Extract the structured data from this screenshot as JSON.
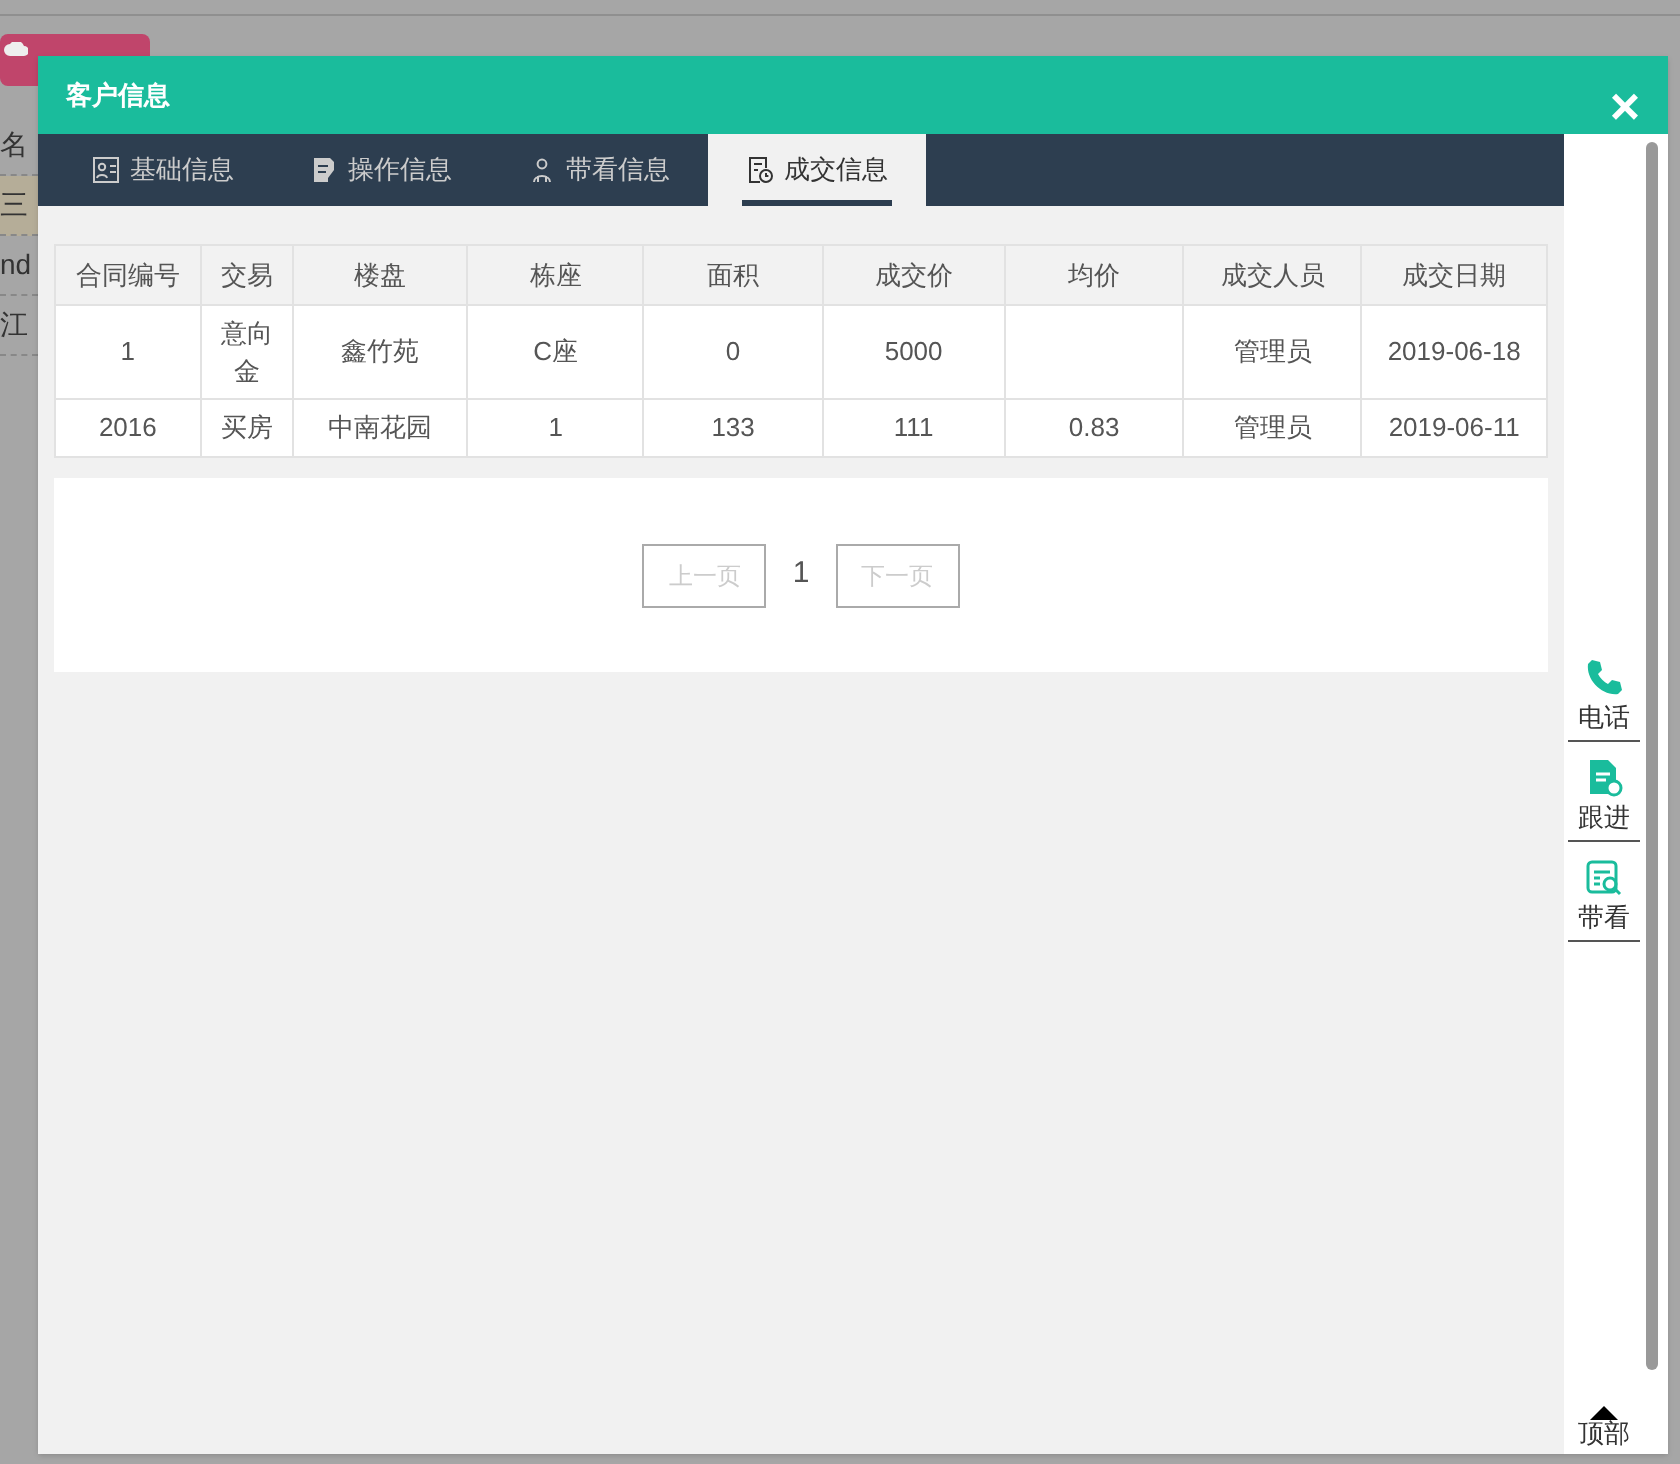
{
  "background": {
    "rows": [
      {
        "text": "名",
        "selected": false
      },
      {
        "text": "三",
        "selected": true
      },
      {
        "text": "nd",
        "selected": false
      },
      {
        "text": "江",
        "selected": false
      }
    ]
  },
  "dialog": {
    "title": "客户信息",
    "close": "×"
  },
  "tabs": [
    {
      "label": "基础信息",
      "kind": "profile",
      "selected": false
    },
    {
      "label": "操作信息",
      "kind": "edit",
      "selected": false
    },
    {
      "label": "带看信息",
      "kind": "people",
      "selected": false
    },
    {
      "label": "成交信息",
      "kind": "deal",
      "selected": true
    }
  ],
  "table": {
    "columns": [
      "合同编号",
      "交易",
      "楼盘",
      "栋座",
      "面积",
      "成交价",
      "均价",
      "成交人员",
      "成交日期"
    ],
    "rows": [
      [
        "1",
        "意向金",
        "鑫竹苑",
        "C座",
        "0",
        "5000",
        "",
        "管理员",
        "2019-06-18"
      ],
      [
        "2016",
        "买房",
        "中南花园",
        "1",
        "133",
        "111",
        "0.83",
        "管理员",
        "2019-06-11"
      ]
    ]
  },
  "pagination": {
    "prev": {
      "label": "上一页",
      "disabled": true
    },
    "page": "1",
    "next": {
      "label": "下一页",
      "disabled": true
    }
  },
  "side_actions": [
    {
      "label": "电话",
      "kind": "phone"
    },
    {
      "label": "跟进",
      "kind": "doc"
    },
    {
      "label": "带看",
      "kind": "view"
    }
  ],
  "back_to_top": "顶部"
}
